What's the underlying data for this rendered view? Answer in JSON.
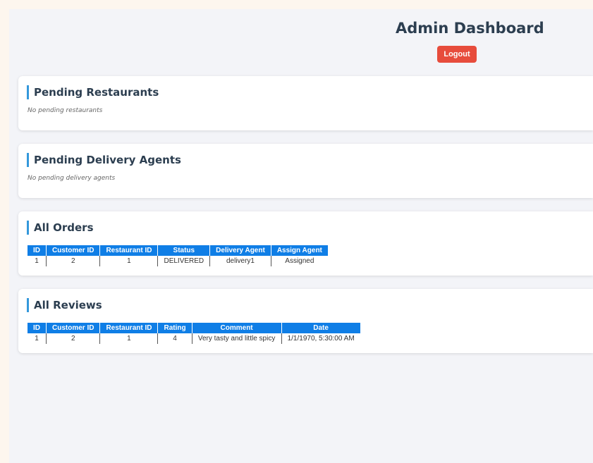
{
  "header": {
    "title": "Admin Dashboard",
    "logout_label": "Logout"
  },
  "pending_restaurants": {
    "title": "Pending Restaurants",
    "empty_text": "No pending restaurants"
  },
  "pending_delivery_agents": {
    "title": "Pending Delivery Agents",
    "empty_text": "No pending delivery agents"
  },
  "orders": {
    "title": "All Orders",
    "columns": [
      "ID",
      "Customer ID",
      "Restaurant ID",
      "Status",
      "Delivery Agent",
      "Assign Agent"
    ],
    "rows": [
      [
        "1",
        "2",
        "1",
        "DELIVERED",
        "delivery1",
        "Assigned"
      ]
    ]
  },
  "reviews": {
    "title": "All Reviews",
    "columns": [
      "ID",
      "Customer ID",
      "Restaurant ID",
      "Rating",
      "Comment",
      "Date"
    ],
    "rows": [
      [
        "1",
        "2",
        "1",
        "4",
        "Very tasty and little spicy",
        "1/1/1970, 5:30:00 AM"
      ]
    ]
  },
  "colors": {
    "accent": "#3498db",
    "table_header": "#0f7ee6",
    "logout": "#e74c3c",
    "heading": "#2c3e50"
  }
}
